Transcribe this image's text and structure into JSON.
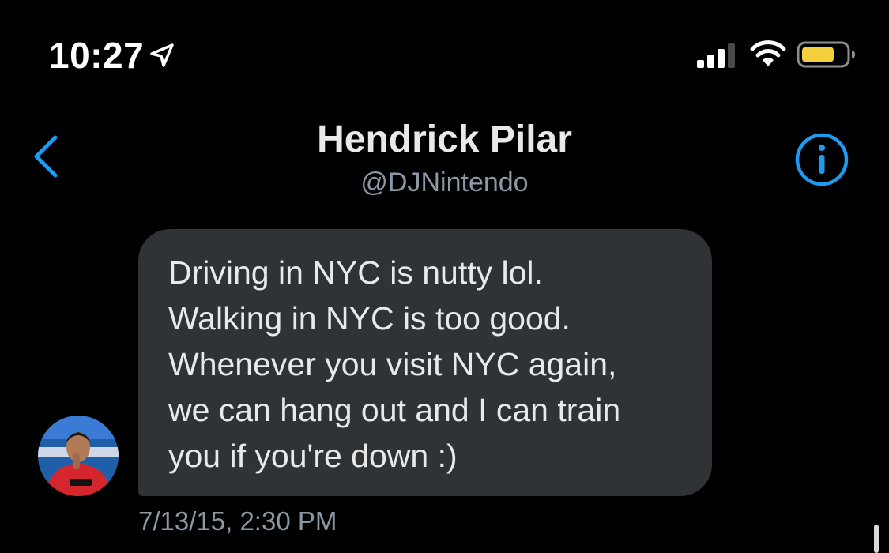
{
  "status_bar": {
    "time": "10:27",
    "location_icon": "location-arrow-icon",
    "signal_icon": "cellular-signal-icon",
    "wifi_icon": "wifi-icon",
    "battery_icon": "battery-icon",
    "battery_color": "#f4d03f"
  },
  "header": {
    "back_icon": "chevron-left-icon",
    "name": "Hendrick Pilar",
    "handle": "@DJNintendo",
    "info_icon": "info-circle-icon",
    "accent_color": "#1d9bf0"
  },
  "conversation": {
    "messages": [
      {
        "avatar_icon": "contact-avatar",
        "text": "Driving in NYC is nutty lol.\nWalking in NYC is too good.\nWhenever you visit NYC again,\nwe can hang out and I can train\nyou if you're down :)",
        "timestamp": "7/13/15, 2:30 PM",
        "bubble_color": "#2f3336"
      }
    ]
  }
}
